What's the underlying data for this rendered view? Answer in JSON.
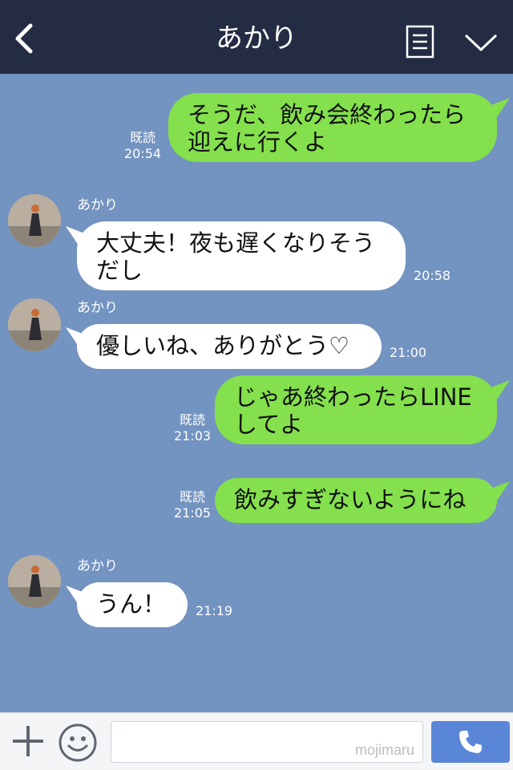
{
  "header": {
    "title": "あかり",
    "back_icon": "chevron-left-icon",
    "menu_icon": "notes-icon",
    "expand_icon": "chevron-down-icon"
  },
  "messages": [
    {
      "side": "right",
      "text": "そうだ、飲み会終わったら\n迎えに行くよ",
      "read": "既読",
      "time": "20:54"
    },
    {
      "side": "left",
      "name": "あかり",
      "text": "大丈夫！夜も遅くなりそう\nだし",
      "time": "20:58"
    },
    {
      "side": "left",
      "name": "あかり",
      "text": "優しいね、ありがとう♡",
      "time": "21:00"
    },
    {
      "side": "right",
      "text": "じゃあ終わったらLINE\nしてよ",
      "read": "既読",
      "time": "21:03"
    },
    {
      "side": "right",
      "text": "飲みすぎないようにね",
      "read": "既読",
      "time": "21:05"
    },
    {
      "side": "left",
      "name": "あかり",
      "text": "うん！",
      "time": "21:19"
    }
  ],
  "footer": {
    "plus_icon": "plus-icon",
    "emoji_icon": "smiley-icon",
    "input_value": "",
    "watermark": "mojimaru",
    "call_icon": "phone-icon"
  },
  "colors": {
    "header_bg": "#232c43",
    "chat_bg": "#7393c0",
    "sent_bubble": "#84e04c",
    "received_bubble": "#ffffff",
    "call_button": "#5a86d8"
  }
}
